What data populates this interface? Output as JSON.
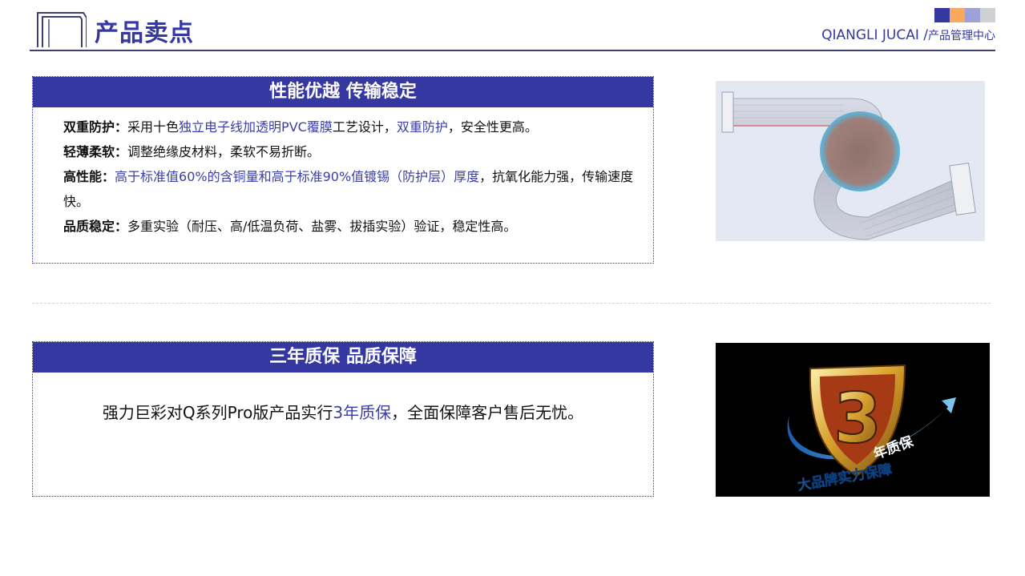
{
  "header": {
    "title": "产品卖点",
    "brand": "QIANGLI JUCAI /",
    "brand_sub": "产品管理中心",
    "swatch_colors": [
      "#3438a0",
      "#f7a960",
      "#9ea1d6",
      "#cfd0d4"
    ]
  },
  "panels": {
    "performance": {
      "heading": "性能优越 传输稳定",
      "features": [
        {
          "label": "双重防护",
          "sep": "：",
          "t1": "采用十色",
          "h1": "独立电子线加透明PVC覆膜",
          "t2": "工艺设计，",
          "h2": "双重防护",
          "t3": "，安全性更高。"
        },
        {
          "label": "轻薄柔软",
          "sep": "：",
          "t1": "调整绝缘皮材料，柔软不易折断。"
        },
        {
          "label": "高性能",
          "sep": "：",
          "h1": "高于标准值60%的含铜量和高于标准90%值镀锡（防护层）厚度",
          "t1": "，抗氧化能力强，传输速度快。"
        },
        {
          "label": "品质稳定",
          "sep": "：",
          "t1": "多重实验（耐压、高/低温负荷、盐雾、拔插实验）验证，稳定性高。"
        }
      ]
    },
    "warranty": {
      "heading": "三年质保 品质保障",
      "t1": "强力巨彩对Q系列Pro版产品实行",
      "h1": "3年质保",
      "t2": "，全面保障客户售后无忧。"
    }
  },
  "badge": {
    "number": "3",
    "ribbon": "年质保",
    "slogan": "大品牌实力保障"
  },
  "colors": {
    "accent": "#3438a0",
    "highlight": "#3a3fa8"
  }
}
